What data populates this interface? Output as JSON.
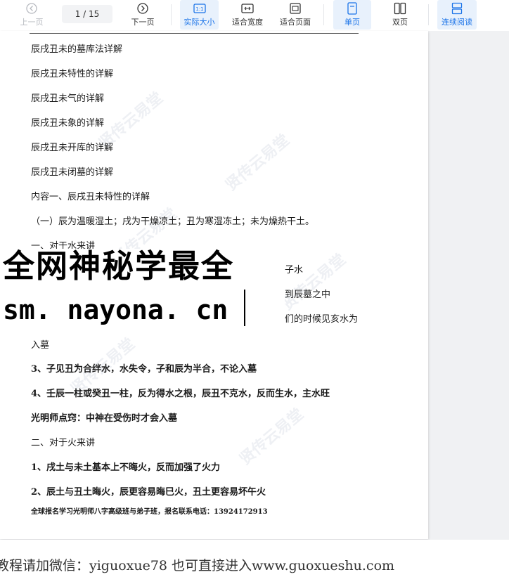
{
  "toolbar": {
    "prev_label": "上一页",
    "page_indicator": "1 / 15",
    "next_label": "下一页",
    "actual_size_label": "实际大小",
    "fit_width_label": "适合宽度",
    "fit_page_label": "适合页面",
    "single_page_label": "单页",
    "double_page_label": "双页",
    "continuous_label": "连续阅读",
    "active_color": "#1a73e8"
  },
  "document": {
    "lines": [
      "辰戌丑未的墓库法详解",
      "辰戌丑未特性的详解",
      "辰戌丑未气的详解",
      "辰戌丑未象的详解",
      "辰戌丑未开库的详解",
      "辰戌丑未闭墓的详解",
      "内容一、辰戌丑未特性的详解",
      "（一）辰为温暖湿土；戌为干燥凉土；丑为寒湿冻土；未为燥热干土。",
      "一、对于水来讲",
      "子水",
      "到辰墓之中",
      "们的时候见亥水为",
      "入墓",
      "3、子见丑为合绊水，水失令，子和辰为半合，不论入墓",
      "4、壬辰一柱或癸丑一柱，反为得水之根，辰丑不克水，反而生水，主水旺",
      "光明师点窍：中神在受伤时才会入墓",
      "二、对于火来讲",
      "1、戌土与未土基本上不晦火，反而加强了火力",
      "2、辰土与丑土晦火，辰更容易晦巳火，丑土更容易坏午火"
    ],
    "footer_note": "全球报名学习光明师八字高级班与弟子班，报名联系电话：13924172913",
    "watermark": "贤传云易堂"
  },
  "overlay": {
    "title": "全网神秘学最全",
    "url": "sm. nayona. cn"
  },
  "bottom_banner": {
    "text": "教程请加微信：yiguoxue78  也可直接进入www.guoxueshu.com"
  }
}
